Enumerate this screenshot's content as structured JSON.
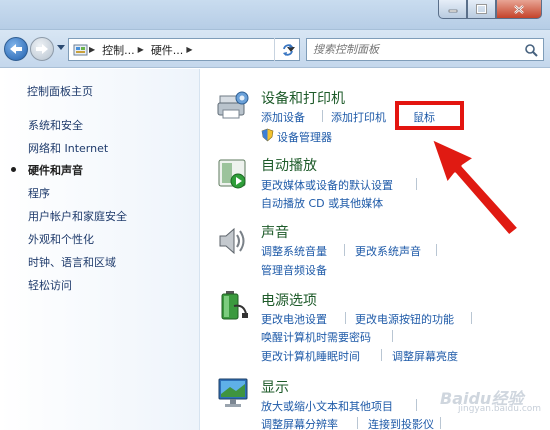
{
  "window": {
    "minimize_icon": "minimize-icon",
    "maximize_icon": "maximize-icon",
    "close_icon": "close-icon"
  },
  "address": {
    "crumbs": [
      "控制...",
      "硬件..."
    ],
    "search_placeholder": "搜索控制面板"
  },
  "sidebar": {
    "items": [
      {
        "label": "控制面板主页"
      },
      {
        "label": "系统和安全"
      },
      {
        "label": "网络和 Internet"
      },
      {
        "label": "硬件和声音",
        "active": true
      },
      {
        "label": "程序"
      },
      {
        "label": "用户帐户和家庭安全"
      },
      {
        "label": "外观和个性化"
      },
      {
        "label": "时钟、语言和区域"
      },
      {
        "label": "轻松访问"
      }
    ]
  },
  "sections": {
    "devices": {
      "title": "设备和打印机",
      "links": [
        "添加设备",
        "添加打印机",
        "鼠标"
      ],
      "admin_link": "设备管理器"
    },
    "autoplay": {
      "title": "自动播放",
      "links": [
        "更改媒体或设备的默认设置",
        "自动播放 CD 或其他媒体"
      ]
    },
    "sound": {
      "title": "声音",
      "links": [
        "调整系统音量",
        "更改系统声音",
        "管理音频设备"
      ]
    },
    "power": {
      "title": "电源选项",
      "links": [
        "更改电池设置",
        "更改电源按钮的功能",
        "唤醒计算机时需要密码",
        "更改计算机睡眠时间",
        "调整屏幕亮度"
      ]
    },
    "display": {
      "title": "显示",
      "links": [
        "放大或缩小文本和其他项目",
        "调整屏幕分辨率",
        "连接到投影仪"
      ]
    }
  },
  "watermark": {
    "logo": "Baidu经验",
    "sub": "jingyan.baidu.com"
  },
  "colors": {
    "highlight": "#e3150f",
    "link": "#1e5aa8",
    "title": "#1e5b2a"
  }
}
